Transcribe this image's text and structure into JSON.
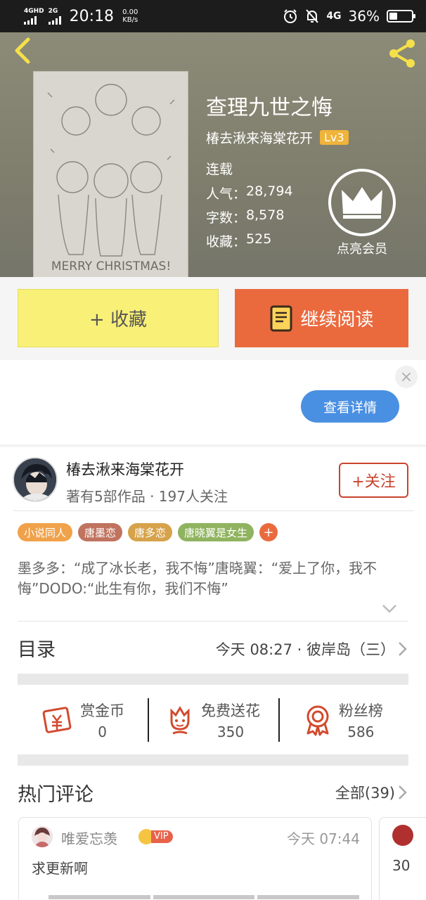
{
  "status_bar": {
    "net1": "4GHD",
    "net2": "2G",
    "time": "20:18",
    "speed_value": "0.00",
    "speed_unit": "KB/s",
    "net3": "4G",
    "battery": "36%"
  },
  "book": {
    "title": "查理九世之悔",
    "author": "椿去湫来海棠花开",
    "level": "Lv3",
    "status": "连载",
    "popularity_label": "人气：",
    "popularity": "28,794",
    "words_label": "字数：",
    "words": "8,578",
    "favorites_label": "收藏：",
    "favorites": "525",
    "member_label": "点亮会员",
    "cover_text": "MERRY CHRISTMAS!"
  },
  "actions": {
    "favorite": "+ 收藏",
    "continue": "继续阅读"
  },
  "ad": {
    "close": "×",
    "detail": "查看详情"
  },
  "author_card": {
    "name": "椿去湫来海棠花开",
    "meta": "著有5部作品 · 197人关注",
    "follow": "+关注"
  },
  "tags": [
    {
      "label": "小说同人",
      "color": "#f0a24a"
    },
    {
      "label": "唐墨恋",
      "color": "#c0735f"
    },
    {
      "label": "唐多恋",
      "color": "#d6a24a"
    },
    {
      "label": "唐晓翼是女生",
      "color": "#8fb35f"
    }
  ],
  "tag_add": "+",
  "summary": "墨多多：“成了冰长老，我不悔”唐晓翼：“爱上了你，我不悔”DODO:“此生有你，我们不悔”",
  "toc": {
    "title": "目录",
    "latest": "今天 08:27 · 彼岸岛（三）"
  },
  "support": [
    {
      "label": "赏金币",
      "value": "0",
      "icon": "reward-coin-icon"
    },
    {
      "label": "免费送花",
      "value": "350",
      "icon": "flower-icon"
    },
    {
      "label": "粉丝榜",
      "value": "586",
      "icon": "medal-icon"
    }
  ],
  "hot_comments": {
    "title": "热门评论",
    "all": "全部(39)",
    "items": [
      {
        "user": "唯爱忘羡",
        "badge": "VIP",
        "time": "今天 07:44",
        "text": "求更新啊"
      },
      {
        "text": "30"
      }
    ]
  },
  "colors": {
    "accent_orange": "#ea6a3e",
    "fav_yellow": "#f9f078",
    "follow_red": "#c9432d",
    "detail_blue": "#4a90e2",
    "level_gold": "#f0b43a"
  }
}
